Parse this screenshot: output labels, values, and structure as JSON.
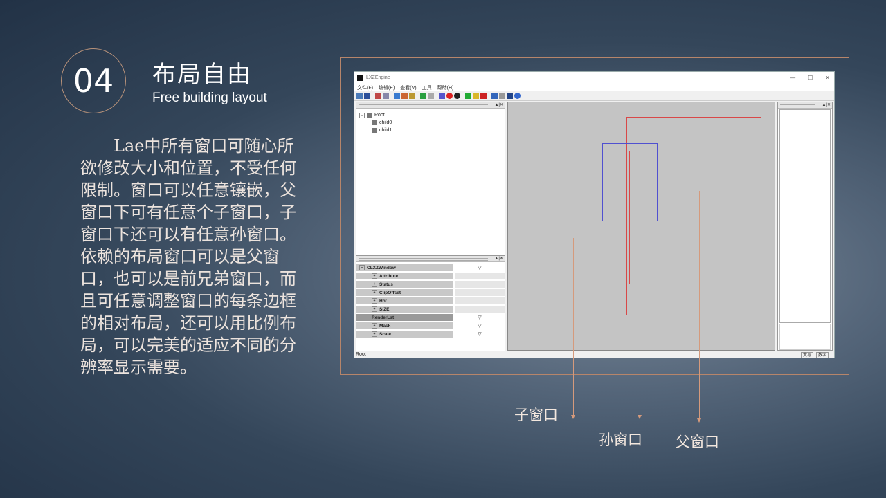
{
  "slide": {
    "number": "04",
    "title_cn": "布局自由",
    "title_en": "Free building layout",
    "body": "Lae中所有窗口可随心所欲修改大小和位置，不受任何限制。窗口可以任意镶嵌，父窗口下可有任意个子窗口，子窗口下还可以有任意孙窗口。依赖的布局窗口可以是父窗口，也可以是前兄弟窗口，而且可任意调整窗口的每条边框的相对布局，还可以用比例布局，可以完美的适应不同的分辨率显示需要。"
  },
  "annotations": {
    "child": "子窗口",
    "grandchild": "孙窗口",
    "parent": "父窗口"
  },
  "app": {
    "window_title": "LXZEngine",
    "controls": {
      "minimize": "—",
      "maximize": "☐",
      "close": "✕"
    },
    "menu": [
      "文件(F)",
      "编辑(E)",
      "查看(V)",
      "工具",
      "帮助(H)"
    ],
    "tree": {
      "root": "Root",
      "children": [
        "child0",
        "child1"
      ]
    },
    "pane_buttons": "▲|✕",
    "properties": [
      {
        "name": "CLXZWindow",
        "value": "▽",
        "expander": "−",
        "dark": false
      },
      {
        "name": "Attribute",
        "value": "",
        "expander": "+",
        "dark": false
      },
      {
        "name": "Status",
        "value": "",
        "expander": "+",
        "dark": false
      },
      {
        "name": "ClipOffset",
        "value": "",
        "expander": "+",
        "dark": false
      },
      {
        "name": "Hot",
        "value": "",
        "expander": "+",
        "dark": false
      },
      {
        "name": "SIZE",
        "value": "",
        "expander": "+",
        "dark": false
      },
      {
        "name": "RenderLst",
        "value": "▽",
        "expander": "",
        "dark": true
      },
      {
        "name": "Mask",
        "value": "▽",
        "expander": "+",
        "dark": false
      },
      {
        "name": "Scale",
        "value": "▽",
        "expander": "+",
        "dark": false
      }
    ],
    "status": {
      "left": "Root",
      "caps": "大写",
      "num": "数字"
    },
    "colors": {
      "parent_rect": "#d84848",
      "child_rect": "#d84848",
      "grandchild_rect": "#5050d0"
    }
  }
}
